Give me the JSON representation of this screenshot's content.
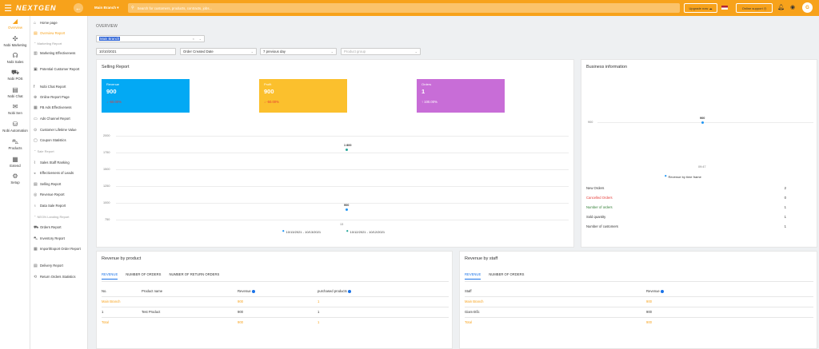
{
  "topbar": {
    "logo": "NEXTGEN",
    "branch": "Main Branch",
    "search_placeholder": "Search for customers, products, contracts, jobs...",
    "upgrade_label": "Upgrade now",
    "online_label": "Online support",
    "avatar_initial": "G"
  },
  "nav": [
    {
      "label": "Overview",
      "icon": "pie-icon"
    },
    {
      "label": "Nobi Marketing",
      "icon": "marketing-icon"
    },
    {
      "label": "Nobi Sales",
      "icon": "headset-icon"
    },
    {
      "label": "Nobi POS",
      "icon": "cart-icon"
    },
    {
      "label": "Nobi Chat",
      "icon": "chat-icon"
    },
    {
      "label": "Nobi Sen",
      "icon": "send-icon"
    },
    {
      "label": "Nobi Automation",
      "icon": "automation-icon"
    },
    {
      "label": "Products",
      "icon": "products-icon"
    },
    {
      "label": "Extend",
      "icon": "extend-icon"
    },
    {
      "label": "Setup",
      "icon": "gear-icon"
    }
  ],
  "subnav": {
    "home": "Home page",
    "overview": "Overview Report",
    "marketing_section": "Marketing Report",
    "marketing_items": [
      "Marketing Effectiveness",
      "Potential Customer Report",
      "Nobi Chat Report",
      "Online Report Page",
      "FB Ads Effectiveness",
      "Ads Channel Report",
      "Customer Lifetime Value",
      "Coupon Statistics"
    ],
    "sale_section": "Sale Report",
    "sale_items": [
      "Sales Staff Ranking",
      "Effectiveness of Leads",
      "Selling Report",
      "Revenue Report",
      "Data Sale Report"
    ],
    "pos_section": "NEON Landing Report",
    "pos_items": [
      "Orders Report",
      "Inventory Report",
      "Import/Export Order Report",
      "Delivery Report",
      "Return Orders Statistics"
    ]
  },
  "page_title": "OVERVIEW",
  "filters": {
    "branch": "Main Branch",
    "date": "10/10/2021",
    "date_type": "Order Created Date",
    "period": "7 previous day",
    "product_group_placeholder": "Product group"
  },
  "selling": {
    "title": "Selling Report",
    "cards": [
      {
        "label": "Revenue",
        "value": "900",
        "delta": "↓ -50.00%",
        "color": "#03a9f4"
      },
      {
        "label": "Profit",
        "value": "900",
        "delta": "↓ -50.00%",
        "color": "#fbc02d"
      },
      {
        "label": "Orders",
        "value": "1",
        "delta": "↑ 100.00%",
        "color": "#c86dd7"
      }
    ]
  },
  "business": {
    "title": "Business information",
    "stats": [
      {
        "label": "New Orders",
        "value": "2"
      },
      {
        "label": "Cancelled Orders",
        "value": "0"
      },
      {
        "label": "Number of orders",
        "value": "1"
      },
      {
        "label": "Sold quantity",
        "value": "1"
      },
      {
        "label": "Number of customers",
        "value": "1"
      }
    ]
  },
  "chart_data": [
    {
      "type": "line",
      "categories": [
        "13"
      ],
      "series": [
        {
          "name": "10/13/2021 - 10/13/2021",
          "values": [
            900
          ],
          "color": "#2196f3"
        },
        {
          "name": "10/12/2021 - 10/12/2021",
          "values": [
            1800
          ],
          "color": "#26a69a"
        }
      ],
      "point_labels": [
        "900",
        "1 800"
      ],
      "y_ticks": [
        "2000",
        "1750",
        "1500",
        "1250",
        "1000",
        "750"
      ],
      "ylim": [
        750,
        2000
      ],
      "grid": true,
      "legend": "bottom"
    },
    {
      "type": "line",
      "categories": [
        "09:47"
      ],
      "series": [
        {
          "name": "Revenue by time frame",
          "values": [
            900
          ],
          "color": "#2196f3"
        }
      ],
      "point_labels": [
        "900"
      ],
      "y_ticks": [
        "900"
      ],
      "grid": true,
      "legend": "bottom"
    }
  ],
  "rev_product": {
    "title": "Revenue by product",
    "tabs": [
      "REVENUE",
      "NUMBER OF ORDERS",
      "NUMBER OF RETURN ORDERS"
    ],
    "headers": [
      "No.",
      "Product name",
      "Revenue",
      "purchased products"
    ],
    "rows": [
      {
        "no": "Main Branch",
        "name": "",
        "rev": "900",
        "qty": "1"
      },
      {
        "no": "1",
        "name": "Test Product",
        "rev": "900",
        "qty": "1"
      },
      {
        "no": "Total",
        "name": "",
        "rev": "900",
        "qty": "1"
      }
    ]
  },
  "rev_staff": {
    "title": "Revenue by staff",
    "tabs": [
      "REVENUE",
      "NUMBER OF ORDERS"
    ],
    "headers": [
      "Staff",
      "Revenue"
    ],
    "rows": [
      {
        "staff": "Main Branch",
        "rev": "900"
      },
      {
        "staff": "Giam Đốc",
        "rev": "900"
      },
      {
        "staff": "Total",
        "rev": "900"
      }
    ]
  }
}
